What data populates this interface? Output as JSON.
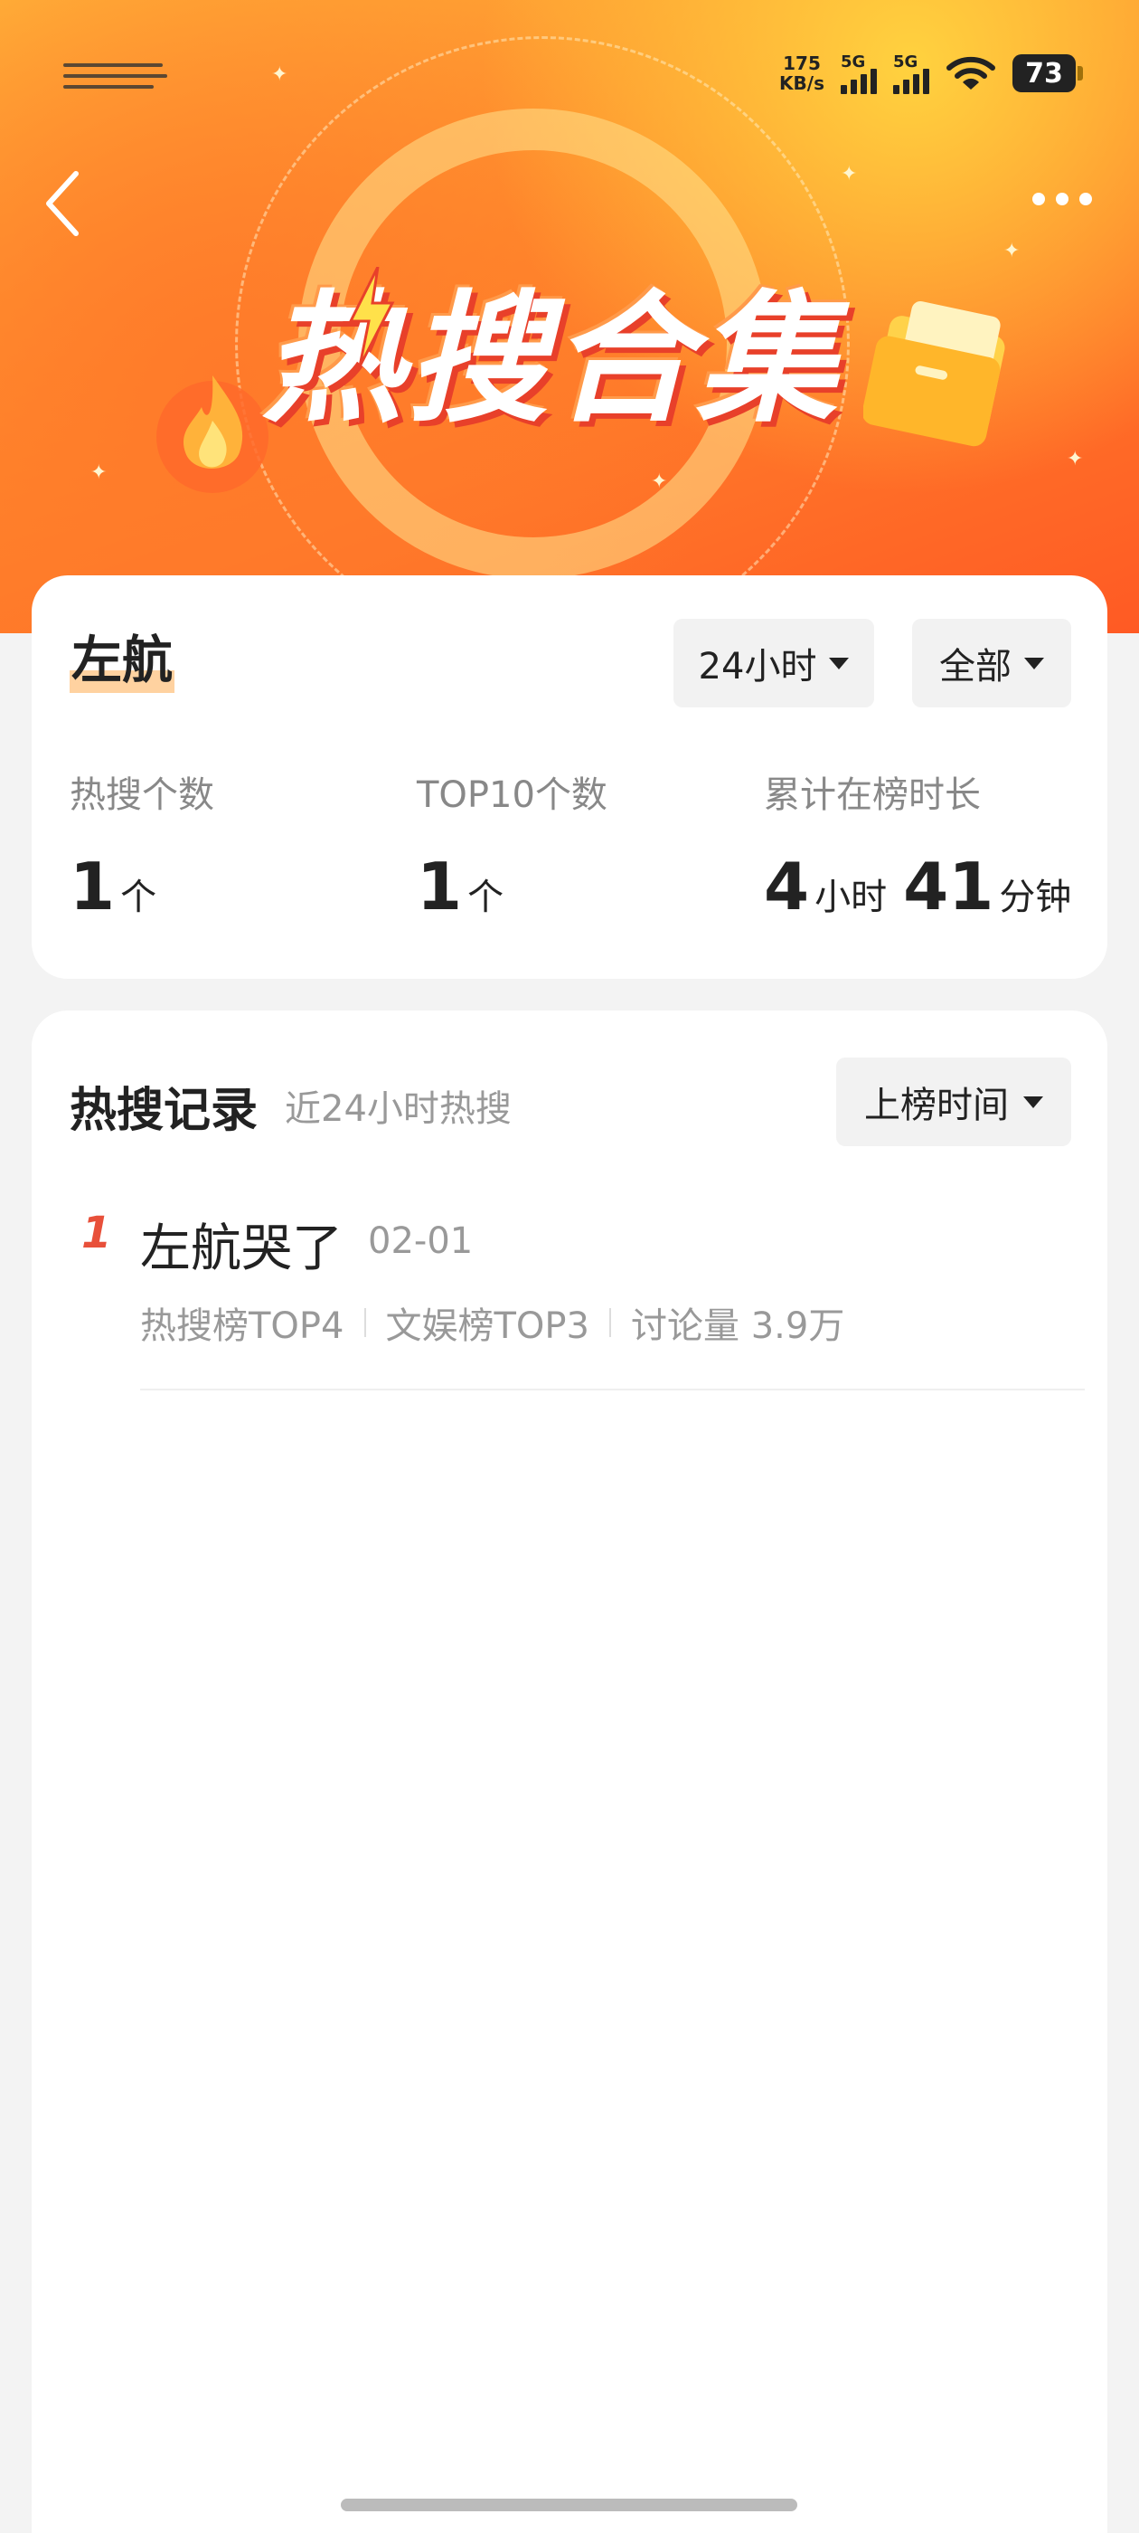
{
  "status_bar": {
    "net_speed_value": "175",
    "net_speed_unit": "KB/s",
    "signal1_label": "5G",
    "signal2_label": "5G",
    "battery": "73"
  },
  "banner": {
    "title": "热搜合集"
  },
  "summary": {
    "person_name": "左航",
    "time_filter": "24小时",
    "scope_filter": "全部",
    "stats": [
      {
        "label": "热搜个数",
        "value": "1",
        "unit": "个"
      },
      {
        "label": "TOP10个数",
        "value": "1",
        "unit": "个"
      },
      {
        "label": "累计在榜时长",
        "hours": "4",
        "hours_unit": "小时",
        "minutes": "41",
        "minutes_unit": "分钟"
      }
    ]
  },
  "records": {
    "title": "热搜记录",
    "subtitle": "近24小时热搜",
    "sort_label": "上榜时间",
    "items": [
      {
        "rank": "1",
        "title": "左航哭了",
        "date": "02-01",
        "meta1": "热搜榜TOP4",
        "meta2": "文娱榜TOP3",
        "meta3": "讨论量 3.9万"
      }
    ]
  }
}
